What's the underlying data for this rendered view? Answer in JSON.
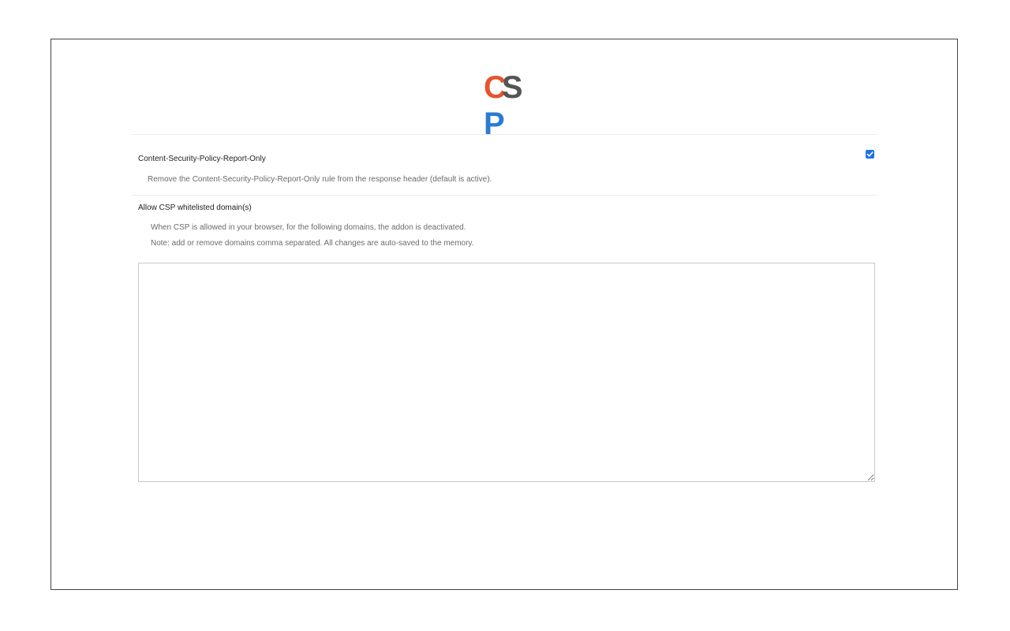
{
  "logo": {
    "c": "C",
    "s": "S",
    "p": "P",
    "colors": {
      "c": "#e8532b",
      "s": "#555555",
      "p": "#2a7cd3"
    }
  },
  "report_only": {
    "label": "Content-Security-Policy-Report-Only",
    "description": "Remove the Content-Security-Policy-Report-Only rule from the response header (default is active).",
    "checked": true,
    "accent": "#1a73e8"
  },
  "whitelist": {
    "label": "Allow CSP whitelisted domain(s)",
    "description_1": "When CSP is allowed in your browser, for the following domains, the addon is deactivated.",
    "description_2": "Note: add or remove domains comma separated. All changes are auto-saved to the memory.",
    "value": ""
  }
}
